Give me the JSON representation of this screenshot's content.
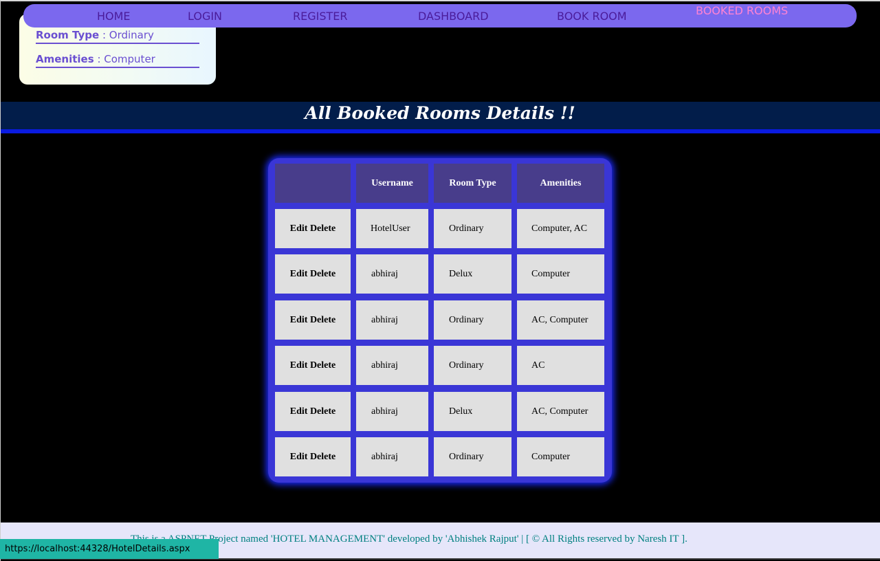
{
  "nav": {
    "items": [
      {
        "label": "HOME"
      },
      {
        "label": "LOGIN"
      },
      {
        "label": "REGISTER"
      },
      {
        "label": "DASHBOARD"
      },
      {
        "label": "BOOK ROOM"
      },
      {
        "label": "BOOKED ROOMS"
      }
    ],
    "active_index": 5
  },
  "info_card": {
    "room_type_label": "Room Type",
    "room_type_value": "Ordinary",
    "amenities_label": "Amenities",
    "amenities_value": "Computer",
    "separator": ":"
  },
  "banner": {
    "title": "All Booked Rooms Details !!"
  },
  "table": {
    "headers": [
      "",
      "Username",
      "Room Type",
      "Amenities"
    ],
    "edit_label": "Edit",
    "delete_label": "Delete",
    "rows": [
      {
        "username": "HotelUser",
        "room_type": "Ordinary",
        "amenities": "Computer, AC"
      },
      {
        "username": "abhiraj",
        "room_type": "Delux",
        "amenities": "Computer"
      },
      {
        "username": "abhiraj",
        "room_type": "Ordinary",
        "amenities": "AC, Computer"
      },
      {
        "username": "abhiraj",
        "room_type": "Ordinary",
        "amenities": "AC"
      },
      {
        "username": "abhiraj",
        "room_type": "Delux",
        "amenities": "AC, Computer"
      },
      {
        "username": "abhiraj",
        "room_type": "Ordinary",
        "amenities": "Computer"
      }
    ]
  },
  "footer": {
    "text": "This is a ASPNET Project named 'HOTEL MANAGEMENT' developed by 'Abhishek Rajput' | [ © All Rights reserved by Naresh IT ]."
  },
  "status_bar": {
    "url": "https://localhost:44328/HotelDetails.aspx"
  },
  "colors": {
    "nav_bg": "#7b68ee",
    "nav_text": "#4b1c9a",
    "nav_active": "#ff83d3",
    "table_panel": "#3a36d6",
    "table_header": "#483d8b",
    "footer_text": "#008080"
  }
}
